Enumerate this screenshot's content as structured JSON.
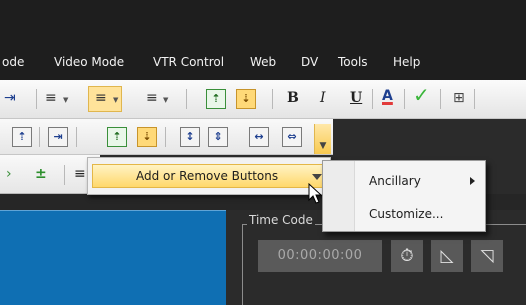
{
  "menubar": {
    "items": [
      "ode",
      "Video Mode",
      "VTR Control",
      "Web",
      "DV",
      "Tools",
      "Help"
    ]
  },
  "toolbar1": {
    "bold_label": "B",
    "italic_label": "I",
    "underline_label": "U",
    "font_color_label": "A",
    "checkmark_icon": "green-check-icon"
  },
  "toolbar3": {
    "plus_label": "±"
  },
  "popup_menu": {
    "add_remove_label": "Add or Remove Buttons"
  },
  "submenu": {
    "items": [
      "Ancillary",
      "Customize..."
    ]
  },
  "timecode": {
    "label": "Time Code",
    "value": "00:00:00:00"
  },
  "colors": {
    "menubar_bg": "#1e1e1e",
    "highlight": "#ffd86b",
    "preview_blue": "#0f6fb3"
  }
}
